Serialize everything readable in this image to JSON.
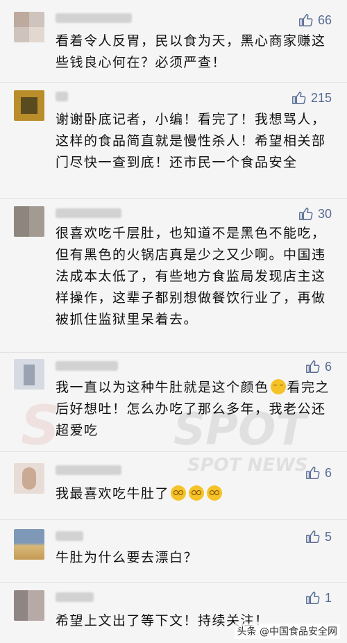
{
  "colors": {
    "like_blue": "#576b95",
    "background": "#f5f5f5"
  },
  "comments": [
    {
      "likes": "66",
      "text": "看着令人反胃，民以食为天，黑心商家赚这些钱良心何在？必须严查！"
    },
    {
      "likes": "215",
      "text": "谢谢卧底记者，小编！看完了！我想骂人，这样的食品简直就是慢性杀人！希望相关部门尽快一查到底！还市民一个食品安全"
    },
    {
      "likes": "30",
      "text": "很喜欢吃千层肚，也知道不是黑色不能吃，但有黑色的火锅店真是少之又少啊。中国违法成本太低了，有些地方食监局发现店主这样操作，这辈子都别想做餐饮行业了，再做被抓住监狱里呆着去。"
    },
    {
      "likes": "6",
      "text_before": "我一直以为这种牛肚就是这个颜色",
      "text_after": "看完之后好想吐！怎么办吃了那么多年，我老公还超爱吃"
    },
    {
      "likes": "6",
      "text": "我最喜欢吃牛肚了"
    },
    {
      "likes": "5",
      "text": "牛肚为什么要去漂白？"
    },
    {
      "likes": "1",
      "text": "希望上文出了等下文！持续关注！"
    }
  ],
  "icons": {
    "like": "thumbs-up-icon",
    "emoji_smirk": "smirk-emoji-icon",
    "emoji_dizzy": "dizzy-emoji-icon"
  },
  "watermark": "SPOT NEWS",
  "footer": "头条 @中国食品安全网"
}
